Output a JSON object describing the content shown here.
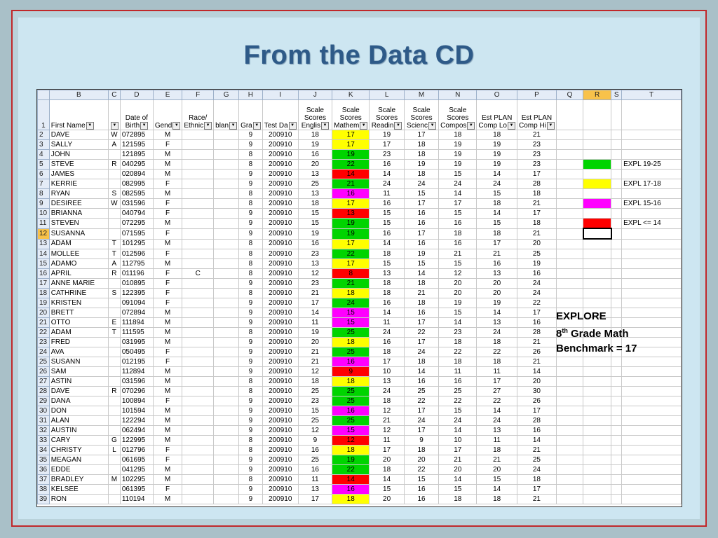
{
  "title": "From the Data CD",
  "columns": [
    "B",
    "C",
    "D",
    "E",
    "F",
    "G",
    "H",
    "I",
    "J",
    "K",
    "L",
    "M",
    "N",
    "O",
    "P",
    "Q",
    "R",
    "S",
    "T"
  ],
  "header": {
    "row": "1",
    "B": "First Name",
    "D": [
      "Date of",
      "Birth"
    ],
    "E": "Gend",
    "F": [
      "Race/",
      "Ethnic"
    ],
    "G": "blan",
    "H": "Gra",
    "I": "Test Da",
    "J": [
      "Scale",
      "Scores",
      "Englis"
    ],
    "K": [
      "Scale",
      "Scores",
      "Mathem"
    ],
    "L": [
      "Scale",
      "Scores",
      "Readin"
    ],
    "M": [
      "Scale",
      "Scores",
      "Scienc"
    ],
    "N": [
      "Scale",
      "Scores",
      "Compos"
    ],
    "O": [
      "Est PLAN",
      "Comp Lo"
    ],
    "P": [
      "Est PLAN",
      "Comp Hi"
    ]
  },
  "rows": [
    [
      "2",
      "DAVE",
      "W",
      "072895",
      "M",
      "",
      "",
      "9",
      "200910",
      "18",
      "17",
      "19",
      "17",
      "18",
      "18",
      "21",
      "y"
    ],
    [
      "3",
      "SALLY",
      "A",
      "121595",
      "F",
      "",
      "",
      "9",
      "200910",
      "19",
      "17",
      "17",
      "18",
      "19",
      "19",
      "23",
      "y"
    ],
    [
      "4",
      "JOHN",
      "",
      "121895",
      "M",
      "",
      "",
      "8",
      "200910",
      "16",
      "19",
      "23",
      "18",
      "19",
      "19",
      "23",
      "g"
    ],
    [
      "5",
      "STEVE",
      "R",
      "040295",
      "M",
      "",
      "",
      "8",
      "200910",
      "20",
      "22",
      "16",
      "19",
      "19",
      "19",
      "23",
      "g"
    ],
    [
      "6",
      "JAMES",
      "",
      "020894",
      "M",
      "",
      "",
      "9",
      "200910",
      "13",
      "14",
      "14",
      "18",
      "15",
      "14",
      "17",
      "r"
    ],
    [
      "7",
      "KERRIE",
      "",
      "082995",
      "F",
      "",
      "",
      "9",
      "200910",
      "25",
      "21",
      "24",
      "24",
      "24",
      "24",
      "28",
      "g"
    ],
    [
      "8",
      "RYAN",
      "S",
      "082595",
      "M",
      "",
      "",
      "8",
      "200910",
      "13",
      "16",
      "11",
      "15",
      "14",
      "15",
      "18",
      "m"
    ],
    [
      "9",
      "DESIREE",
      "W",
      "031596",
      "F",
      "",
      "",
      "8",
      "200910",
      "18",
      "17",
      "16",
      "17",
      "17",
      "18",
      "21",
      "y"
    ],
    [
      "10",
      "BRIANNA",
      "",
      "040794",
      "F",
      "",
      "",
      "9",
      "200910",
      "15",
      "13",
      "15",
      "16",
      "15",
      "14",
      "17",
      "r"
    ],
    [
      "11",
      "STEVEN",
      "",
      "072295",
      "M",
      "",
      "",
      "9",
      "200910",
      "15",
      "19",
      "15",
      "16",
      "16",
      "15",
      "18",
      "g"
    ],
    [
      "12",
      "SUSANNA",
      "",
      "071595",
      "F",
      "",
      "",
      "9",
      "200910",
      "19",
      "19",
      "16",
      "17",
      "18",
      "18",
      "21",
      "g"
    ],
    [
      "13",
      "ADAM",
      "T",
      "101295",
      "M",
      "",
      "",
      "8",
      "200910",
      "16",
      "17",
      "14",
      "16",
      "16",
      "17",
      "20",
      "y"
    ],
    [
      "14",
      "MOLLEE",
      "T",
      "012596",
      "F",
      "",
      "",
      "8",
      "200910",
      "23",
      "22",
      "18",
      "19",
      "21",
      "21",
      "25",
      "g"
    ],
    [
      "15",
      "ADAMO",
      "A",
      "112795",
      "M",
      "",
      "",
      "8",
      "200910",
      "13",
      "17",
      "15",
      "15",
      "15",
      "16",
      "19",
      "y"
    ],
    [
      "16",
      "APRIL",
      "R",
      "011196",
      "F",
      "C",
      "",
      "8",
      "200910",
      "12",
      "8",
      "13",
      "14",
      "12",
      "13",
      "16",
      "r"
    ],
    [
      "17",
      "ANNE MARIE",
      "",
      "010895",
      "F",
      "",
      "",
      "9",
      "200910",
      "23",
      "21",
      "18",
      "18",
      "20",
      "20",
      "24",
      "g"
    ],
    [
      "18",
      "CATHRINE",
      "S",
      "122395",
      "F",
      "",
      "",
      "8",
      "200910",
      "21",
      "18",
      "18",
      "21",
      "20",
      "20",
      "24",
      "y"
    ],
    [
      "19",
      "KRISTEN",
      "",
      "091094",
      "F",
      "",
      "",
      "9",
      "200910",
      "17",
      "24",
      "16",
      "18",
      "19",
      "19",
      "22",
      "g"
    ],
    [
      "20",
      "BRETT",
      "",
      "072894",
      "M",
      "",
      "",
      "9",
      "200910",
      "14",
      "15",
      "14",
      "16",
      "15",
      "14",
      "17",
      "m"
    ],
    [
      "21",
      "OTTO",
      "E",
      "111894",
      "M",
      "",
      "",
      "9",
      "200910",
      "11",
      "15",
      "11",
      "17",
      "14",
      "13",
      "16",
      "m"
    ],
    [
      "22",
      "ADAM",
      "T",
      "111595",
      "M",
      "",
      "",
      "8",
      "200910",
      "19",
      "25",
      "24",
      "22",
      "23",
      "24",
      "28",
      "g"
    ],
    [
      "23",
      "FRED",
      "",
      "031995",
      "M",
      "",
      "",
      "9",
      "200910",
      "20",
      "18",
      "16",
      "17",
      "18",
      "18",
      "21",
      "y"
    ],
    [
      "24",
      "AVA",
      "",
      "050495",
      "F",
      "",
      "",
      "9",
      "200910",
      "21",
      "25",
      "18",
      "24",
      "22",
      "22",
      "26",
      "g"
    ],
    [
      "25",
      "SUSANN",
      "",
      "012195",
      "F",
      "",
      "",
      "9",
      "200910",
      "21",
      "16",
      "17",
      "18",
      "18",
      "18",
      "21",
      "m"
    ],
    [
      "26",
      "SAM",
      "",
      "112894",
      "M",
      "",
      "",
      "9",
      "200910",
      "12",
      "9",
      "10",
      "14",
      "11",
      "11",
      "14",
      "r"
    ],
    [
      "27",
      "ASTIN",
      "",
      "031596",
      "M",
      "",
      "",
      "8",
      "200910",
      "18",
      "18",
      "13",
      "16",
      "16",
      "17",
      "20",
      "y"
    ],
    [
      "28",
      "DAVE",
      "R",
      "070296",
      "M",
      "",
      "",
      "8",
      "200910",
      "25",
      "25",
      "24",
      "25",
      "25",
      "27",
      "30",
      "g"
    ],
    [
      "29",
      "DANA",
      "",
      "100894",
      "F",
      "",
      "",
      "9",
      "200910",
      "23",
      "25",
      "18",
      "22",
      "22",
      "22",
      "26",
      "g"
    ],
    [
      "30",
      "DON",
      "",
      "101594",
      "M",
      "",
      "",
      "9",
      "200910",
      "15",
      "16",
      "12",
      "17",
      "15",
      "14",
      "17",
      "m"
    ],
    [
      "31",
      "ALAN",
      "",
      "122294",
      "M",
      "",
      "",
      "9",
      "200910",
      "25",
      "25",
      "21",
      "24",
      "24",
      "24",
      "28",
      "g"
    ],
    [
      "32",
      "AUSTIN",
      "",
      "062494",
      "M",
      "",
      "",
      "9",
      "200910",
      "12",
      "15",
      "12",
      "17",
      "14",
      "13",
      "16",
      "m"
    ],
    [
      "33",
      "CARY",
      "G",
      "122995",
      "M",
      "",
      "",
      "8",
      "200910",
      "9",
      "12",
      "11",
      "9",
      "10",
      "11",
      "14",
      "r"
    ],
    [
      "34",
      "CHRISTY",
      "L",
      "012796",
      "F",
      "",
      "",
      "8",
      "200910",
      "16",
      "18",
      "17",
      "18",
      "17",
      "18",
      "21",
      "y"
    ],
    [
      "35",
      "MEAGAN",
      "",
      "061695",
      "F",
      "",
      "",
      "9",
      "200910",
      "25",
      "19",
      "20",
      "20",
      "21",
      "21",
      "25",
      "g"
    ],
    [
      "36",
      "EDDE",
      "",
      "041295",
      "M",
      "",
      "",
      "9",
      "200910",
      "16",
      "22",
      "18",
      "22",
      "20",
      "20",
      "24",
      "g"
    ],
    [
      "37",
      "BRADLEY",
      "M",
      "102295",
      "M",
      "",
      "",
      "8",
      "200910",
      "11",
      "14",
      "14",
      "15",
      "14",
      "15",
      "18",
      "r"
    ],
    [
      "38",
      "KELSEE",
      "",
      "061395",
      "F",
      "",
      "",
      "9",
      "200910",
      "13",
      "16",
      "15",
      "16",
      "15",
      "14",
      "17",
      "m"
    ],
    [
      "39",
      "RON",
      "",
      "110194",
      "M",
      "",
      "",
      "9",
      "200910",
      "17",
      "18",
      "20",
      "16",
      "18",
      "18",
      "21",
      "y"
    ]
  ],
  "legend": [
    {
      "row": 5,
      "color": "#00d400",
      "label": "EXPL 19-25"
    },
    {
      "row": 7,
      "color": "#ffff00",
      "label": "EXPL 17-18"
    },
    {
      "row": 9,
      "color": "#ff00ff",
      "label": "EXPL 15-16"
    },
    {
      "row": 11,
      "color": "#ff0000",
      "label": "EXPL <= 14"
    }
  ],
  "note": {
    "line1": "EXPLORE",
    "line2_num": "8",
    "line2_sup": "th",
    "line2_rest": " Grade Math",
    "line3": "Benchmark = 17"
  }
}
